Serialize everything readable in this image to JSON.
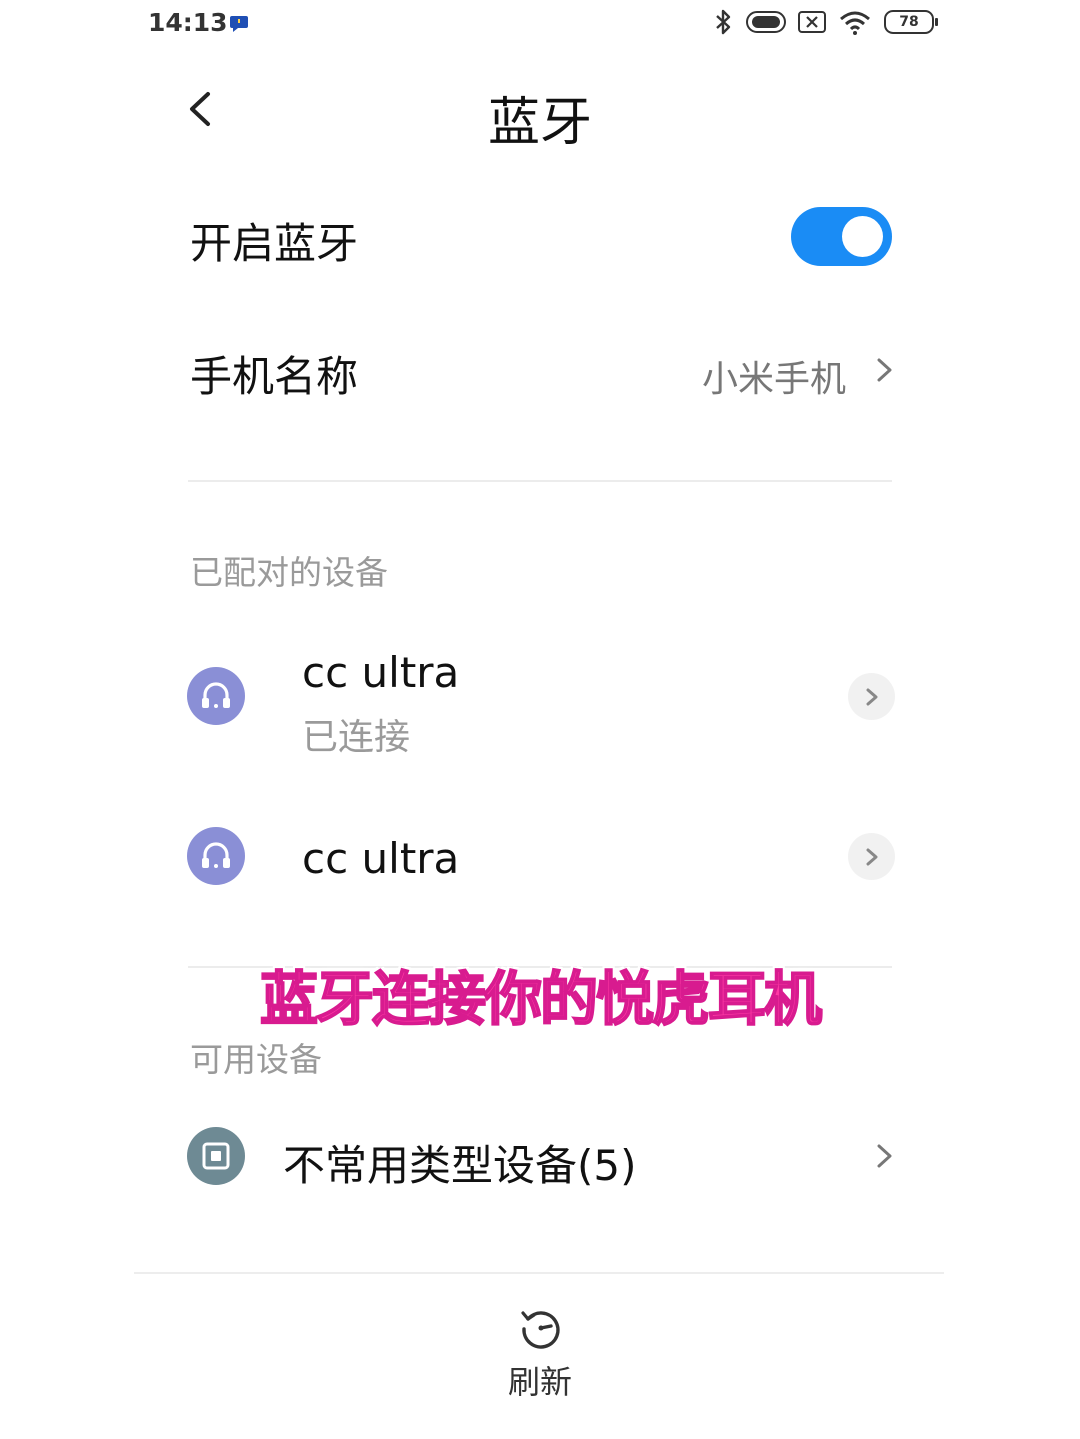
{
  "status_bar": {
    "time": "14:13",
    "battery": "78",
    "icons": [
      "message-icon",
      "bluetooth-icon",
      "toggle-pill-icon",
      "sim-off-icon",
      "wifi-icon",
      "battery-icon"
    ]
  },
  "header": {
    "title": "蓝牙",
    "back_icon": "chevron-left-icon"
  },
  "settings": {
    "bluetooth_toggle_label": "开启蓝牙",
    "bluetooth_enabled": true,
    "phone_name_label": "手机名称",
    "phone_name_value": "小米手机"
  },
  "paired_section": {
    "title": "已配对的设备",
    "devices": [
      {
        "name": "cc ultra",
        "status": "已连接",
        "icon": "headset-icon"
      },
      {
        "name": "cc ultra",
        "status": "",
        "icon": "headset-icon"
      }
    ]
  },
  "overlay_caption": "蓝牙连接你的悦虎耳机",
  "available_section": {
    "title": "可用设备",
    "items": [
      {
        "name": "不常用类型设备(5)",
        "icon": "generic-device-icon"
      }
    ]
  },
  "footer": {
    "refresh_label": "刷新",
    "refresh_icon": "refresh-icon"
  },
  "colors": {
    "accent": "#1a8cf5",
    "headset_icon_bg": "#8a8fd6",
    "generic_icon_bg": "#6e8a94",
    "caption": "#ff3aa6"
  }
}
